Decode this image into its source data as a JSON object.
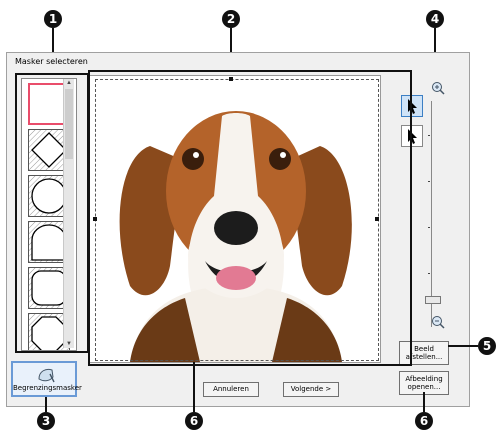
{
  "dialog": {
    "title": "Masker selecteren"
  },
  "callouts": [
    "1",
    "2",
    "3",
    "4",
    "5",
    "6",
    "6"
  ],
  "mask_list": {
    "items": [
      "square",
      "diamond",
      "circle",
      "arch",
      "rounded-rect",
      "octagon"
    ],
    "selected": "square"
  },
  "tools": {
    "select_pointer": "cursor-arrow-icon",
    "move_pointer": "cursor-arrow-icon"
  },
  "zoom": {
    "in_icon": "zoom-in-icon",
    "out_icon": "zoom-out-icon"
  },
  "buttons": {
    "border_mask": "Begrenzingsmasker",
    "cancel": "Annuleren",
    "next": "Volgende >",
    "adjust_image_line1": "Beeld",
    "adjust_image_line2": "afstellen...",
    "open_image_line1": "Afbeelding",
    "open_image_line2": "openen..."
  },
  "colors": {
    "selected_mask": "#e94d6b",
    "callout": "#111111",
    "border_mask_btn": "#6a9ad6"
  }
}
